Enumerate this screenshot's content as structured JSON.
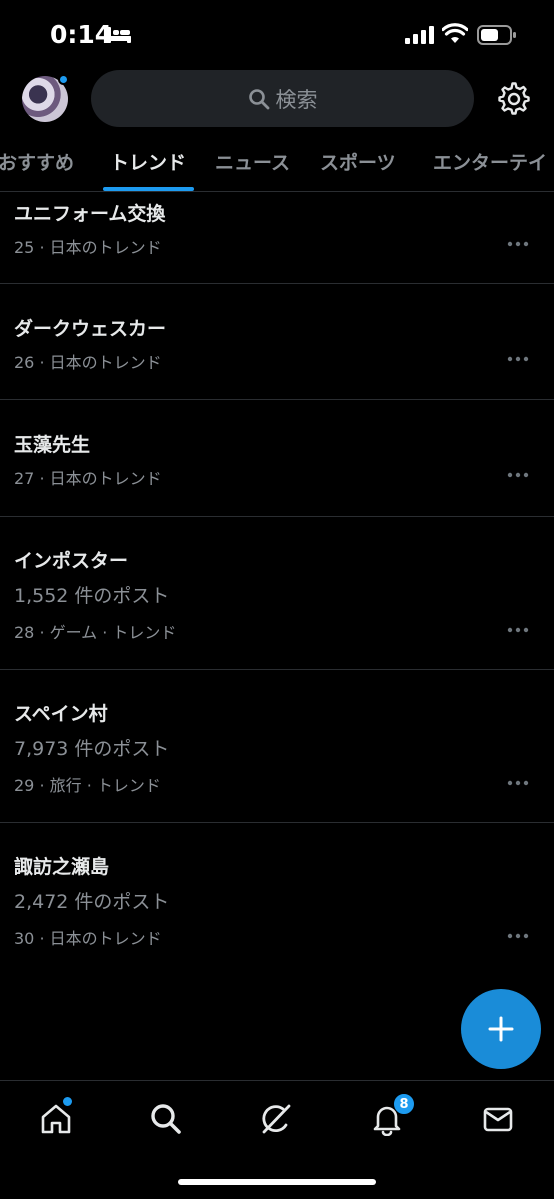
{
  "status_bar": {
    "time": "0:14"
  },
  "header": {
    "search_placeholder": "検索"
  },
  "tabs": [
    {
      "label": "おすすめ"
    },
    {
      "label": "トレンド"
    },
    {
      "label": "ニュース"
    },
    {
      "label": "スポーツ"
    },
    {
      "label": "エンターテイ"
    }
  ],
  "trends": [
    {
      "title": "ユニフォーム交換",
      "posts": "",
      "meta": "25 · 日本のトレンド"
    },
    {
      "title": "ダークウェスカー",
      "posts": "",
      "meta": "26 · 日本のトレンド"
    },
    {
      "title": "玉藻先生",
      "posts": "",
      "meta": "27 · 日本のトレンド"
    },
    {
      "title": "インポスター",
      "posts": "1,552 件のポスト",
      "meta": "28 · ゲーム · トレンド"
    },
    {
      "title": "スペイン村",
      "posts": "7,973 件のポスト",
      "meta": "29 · 旅行 · トレンド"
    },
    {
      "title": "諏訪之瀬島",
      "posts": "2,472 件のポスト",
      "meta": "30 · 日本のトレンド"
    }
  ],
  "bottom_nav": {
    "items": [
      "home-icon",
      "search-icon",
      "grok-icon",
      "bell-icon",
      "mail-icon"
    ],
    "notification_count": "8"
  },
  "colors": {
    "accent": "#1d9bf0",
    "background": "#000000",
    "secondary_text": "#8b9096"
  }
}
